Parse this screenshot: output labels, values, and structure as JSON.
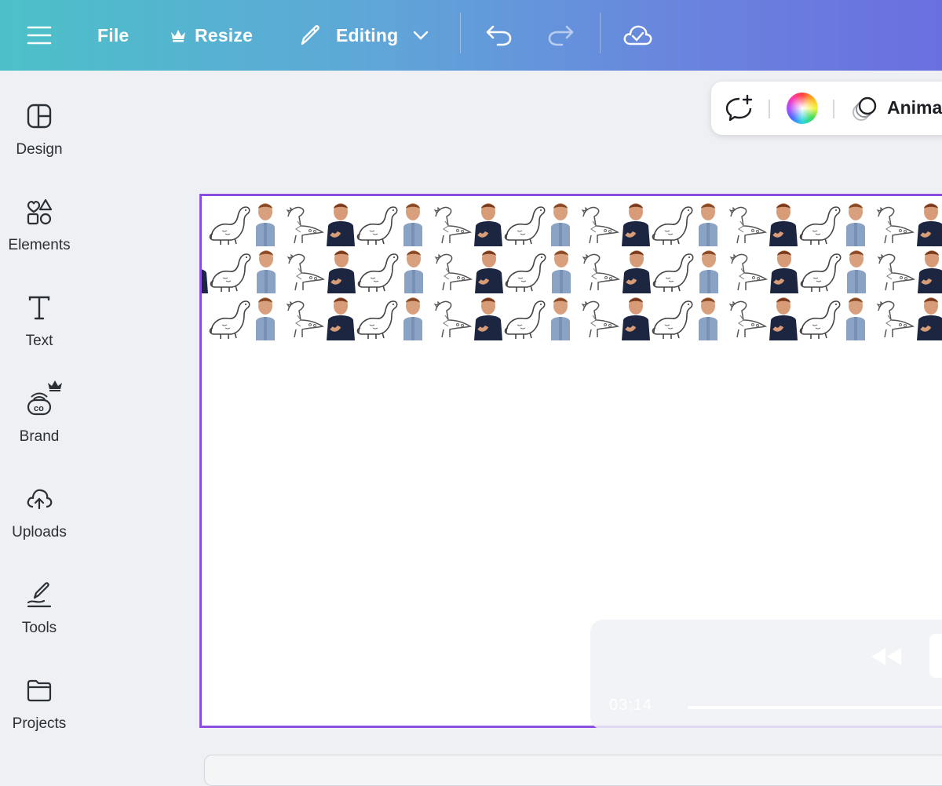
{
  "topbar": {
    "menu_icon": "hamburger-menu-icon",
    "file_label": "File",
    "resize_label": "Resize",
    "resize_icon": "crown-icon",
    "editing_label": "Editing",
    "editing_icon": "pencil-icon",
    "undo_icon": "undo-icon",
    "redo_icon": "redo-icon",
    "cloud_icon": "cloud-saved-icon"
  },
  "sidebar": {
    "items": [
      {
        "label": "Design",
        "icon": "design-layout-icon"
      },
      {
        "label": "Elements",
        "icon": "elements-shapes-icon"
      },
      {
        "label": "Text",
        "icon": "text-t-icon"
      },
      {
        "label": "Brand",
        "icon": "brand-kit-icon",
        "badge": "crown-icon"
      },
      {
        "label": "Uploads",
        "icon": "cloud-upload-icon"
      },
      {
        "label": "Tools",
        "icon": "draw-tools-icon"
      },
      {
        "label": "Projects",
        "icon": "folder-icon"
      }
    ]
  },
  "floating_toolbar": {
    "comment_icon": "add-comment-icon",
    "color_icon": "color-wheel-icon",
    "animate_icon": "animate-icon",
    "animate_label": "Anima"
  },
  "canvas": {
    "pattern": [
      "dinosaur-outline",
      "toddler-photo-blue",
      "dinosaur-spiky-outline",
      "toddler-photo-dark"
    ],
    "accent_color": "#8b4ee0"
  },
  "video_controls": {
    "time": "03:14",
    "rewind_icon": "rewind-icon"
  }
}
